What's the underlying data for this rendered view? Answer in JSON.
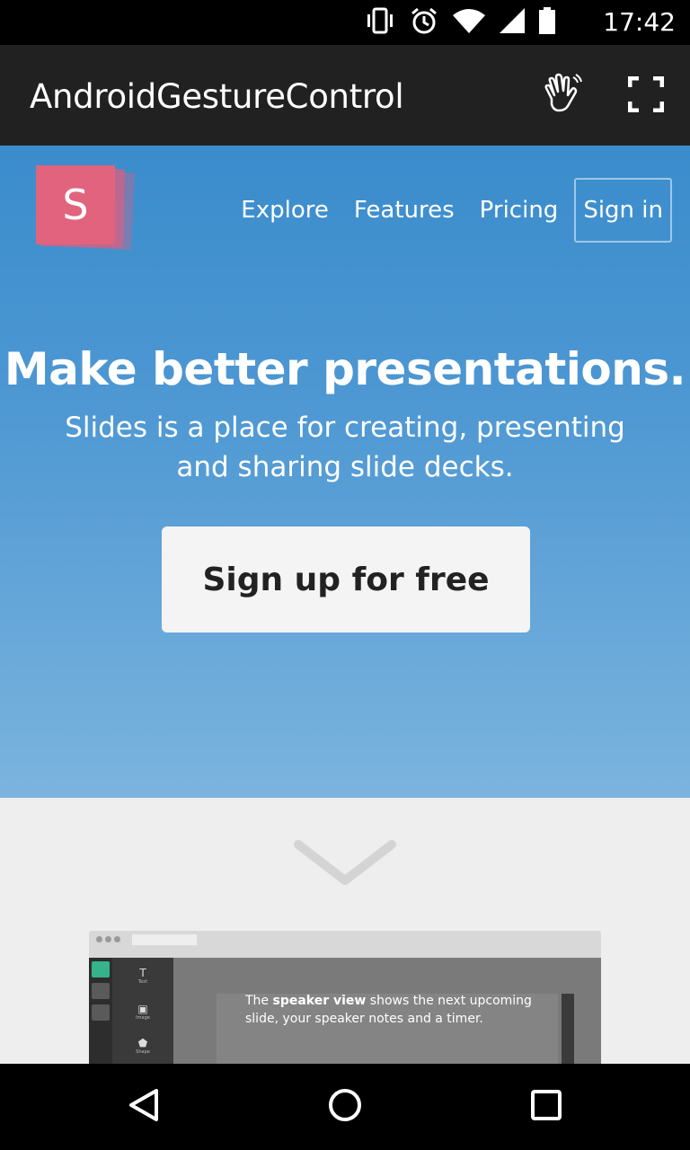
{
  "status_bar": {
    "time": "17:42",
    "icons": [
      "vibrate-icon",
      "alarm-icon",
      "wifi-icon",
      "signal-icon",
      "battery-icon"
    ]
  },
  "app_bar": {
    "title": "AndroidGestureControl",
    "actions": [
      "hand-gesture-icon",
      "fullscreen-icon"
    ],
    "background": "#212121"
  },
  "site": {
    "logo_letter": "S",
    "logo_color": "#e2637d",
    "nav": {
      "explore": "Explore",
      "features": "Features",
      "pricing": "Pricing",
      "sign_in": "Sign in"
    },
    "headline": "Make better presentations.",
    "subhead_line1": "Slides is a place for creating, presenting",
    "subhead_line2": "and sharing slide decks.",
    "cta": "Sign up for free",
    "scroll_icon": "chevron-down-icon",
    "mockup": {
      "tools": [
        {
          "glyph": "T",
          "label": "Text"
        },
        {
          "glyph": "▣",
          "label": "Image"
        },
        {
          "glyph": "⬟",
          "label": "Shape"
        }
      ],
      "note_prefix": "The ",
      "note_bold": "speaker view",
      "note_rest_line1": " shows the next upcoming",
      "note_line2": "slide, your speaker notes and a timer."
    }
  },
  "nav_bar": {
    "buttons": [
      "back-icon",
      "home-icon",
      "recents-icon"
    ]
  }
}
